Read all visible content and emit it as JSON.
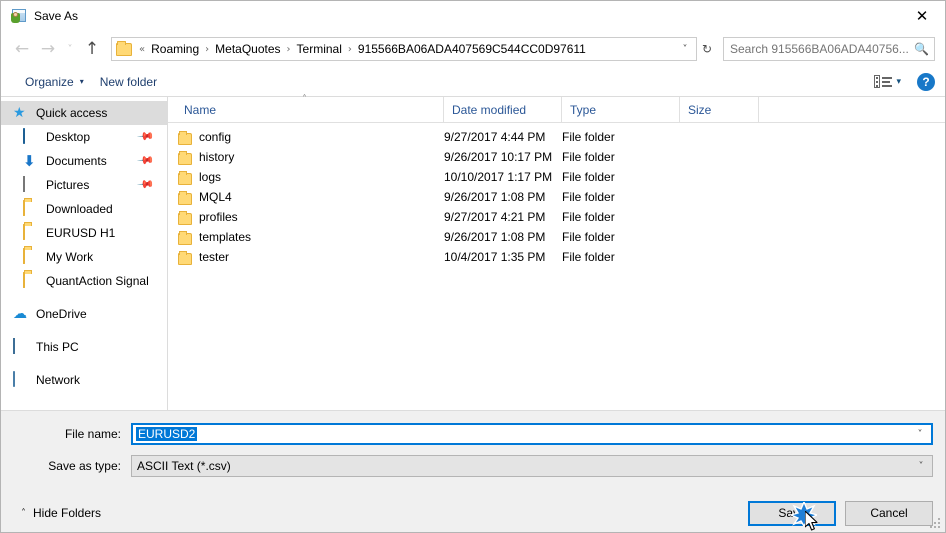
{
  "window": {
    "title": "Save As",
    "icon": "save-as-icon",
    "close_label": "✕"
  },
  "nav": {
    "back_label": "←",
    "forward_label": "→",
    "recent_label": "˅",
    "up_label": "↑",
    "refresh_label": "↻",
    "address_dropdown_label": "˅",
    "breadcrumb_prefix": "«",
    "crumb_separator": "›",
    "breadcrumbs": [
      {
        "label": "Roaming"
      },
      {
        "label": "MetaQuotes"
      },
      {
        "label": "Terminal"
      },
      {
        "label": "915566BA06ADA407569C544CC0D97611"
      }
    ]
  },
  "search": {
    "placeholder": "Search 915566BA06ADA40756...",
    "value": "",
    "icon": "search-icon"
  },
  "toolbar": {
    "organize_label": "Organize",
    "organize_caret": "▾",
    "new_folder_label": "New folder",
    "view_caret": "▾",
    "help_label": "?"
  },
  "sidebar": {
    "items": [
      {
        "label": "Quick access",
        "icon": "star-icon",
        "selected": true,
        "root": true,
        "pinned": false
      },
      {
        "label": "Desktop",
        "icon": "monitor-icon",
        "selected": false,
        "root": false,
        "pinned": true
      },
      {
        "label": "Documents",
        "icon": "download-arrow-icon",
        "selected": false,
        "root": false,
        "pinned": true
      },
      {
        "label": "Pictures",
        "icon": "picture-icon",
        "selected": false,
        "root": false,
        "pinned": true
      },
      {
        "label": "Downloaded",
        "icon": "folder-icon",
        "selected": false,
        "root": false,
        "pinned": false
      },
      {
        "label": "EURUSD H1",
        "icon": "folder-icon",
        "selected": false,
        "root": false,
        "pinned": false
      },
      {
        "label": "My Work",
        "icon": "folder-icon",
        "selected": false,
        "root": false,
        "pinned": false
      },
      {
        "label": "QuantAction Signal",
        "icon": "folder-icon",
        "selected": false,
        "root": false,
        "pinned": false
      },
      {
        "label": "OneDrive",
        "icon": "cloud-icon",
        "selected": false,
        "root": true,
        "pinned": false
      },
      {
        "label": "This PC",
        "icon": "pc-icon",
        "selected": false,
        "root": true,
        "pinned": false
      },
      {
        "label": "Network",
        "icon": "network-icon",
        "selected": false,
        "root": true,
        "pinned": false
      }
    ],
    "pin_glyph": "📌"
  },
  "filelist": {
    "columns": {
      "name": "Name",
      "date_modified": "Date modified",
      "type": "Type",
      "size": "Size"
    },
    "sort_caret": "˄",
    "rows": [
      {
        "name": "config",
        "date": "9/27/2017 4:44 PM",
        "type": "File folder",
        "size": ""
      },
      {
        "name": "history",
        "date": "9/26/2017 10:17 PM",
        "type": "File folder",
        "size": ""
      },
      {
        "name": "logs",
        "date": "10/10/2017 1:17 PM",
        "type": "File folder",
        "size": ""
      },
      {
        "name": "MQL4",
        "date": "9/26/2017 1:08 PM",
        "type": "File folder",
        "size": ""
      },
      {
        "name": "profiles",
        "date": "9/27/2017 4:21 PM",
        "type": "File folder",
        "size": ""
      },
      {
        "name": "templates",
        "date": "9/26/2017 1:08 PM",
        "type": "File folder",
        "size": ""
      },
      {
        "name": "tester",
        "date": "10/4/2017 1:35 PM",
        "type": "File folder",
        "size": ""
      }
    ]
  },
  "form": {
    "file_name_label": "File name:",
    "file_name_value": "EURUSD2",
    "save_as_type_label": "Save as type:",
    "save_as_type_value": "ASCII Text (*.csv)",
    "caret_glyph": "˅"
  },
  "footer": {
    "hide_folders_label": "Hide Folders",
    "hide_folders_caret": "˄",
    "save_label": "Save",
    "cancel_label": "Cancel"
  },
  "colors": {
    "accent": "#0078d7",
    "header_text": "#2b5797",
    "toolbar_text": "#1f3f6e",
    "selection": "#dcdcdc",
    "footer_bg": "#f0f0f0"
  }
}
